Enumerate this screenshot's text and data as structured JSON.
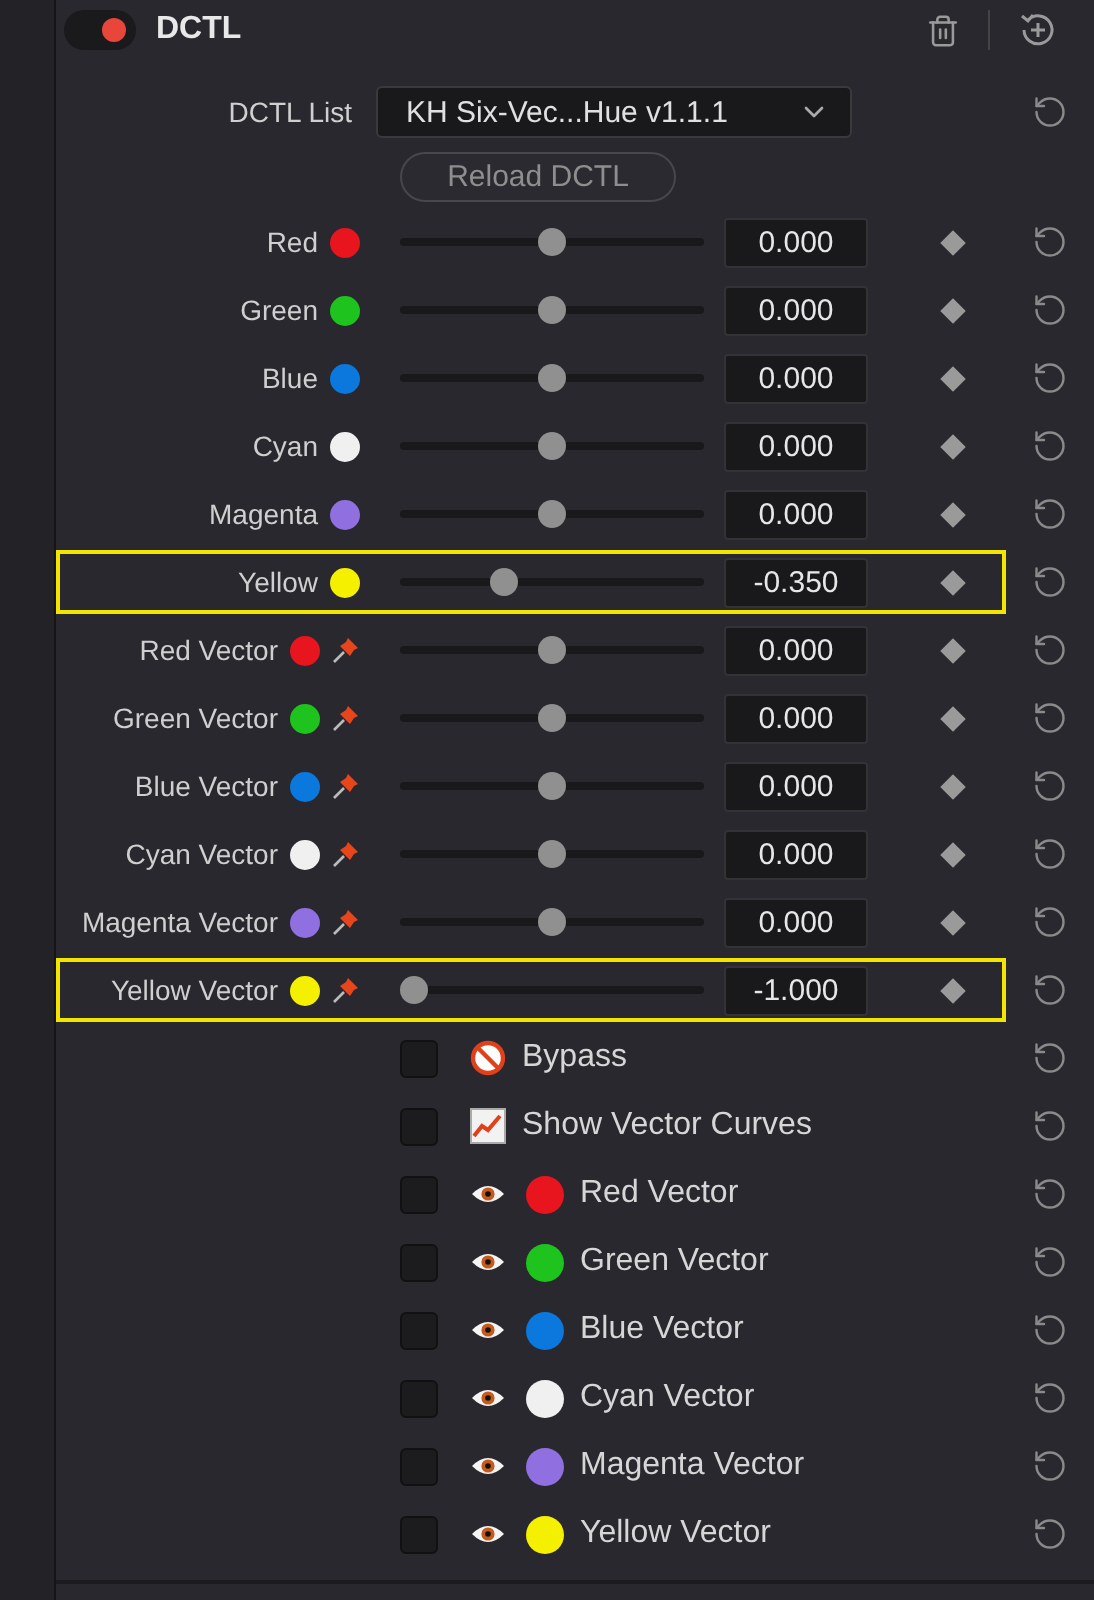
{
  "header": {
    "title": "DCTL",
    "enabled": true
  },
  "dctl_list": {
    "label": "DCTL List",
    "value": "KH Six-Vec...Hue v1.1.1"
  },
  "reload_button": "Reload DCTL",
  "sliders": [
    {
      "label": "Red",
      "color": "#e8141e",
      "pin": false,
      "level": 0.5,
      "value": "0.000",
      "highlighted": false
    },
    {
      "label": "Green",
      "color": "#1ec31e",
      "pin": false,
      "level": 0.5,
      "value": "0.000",
      "highlighted": false
    },
    {
      "label": "Blue",
      "color": "#0a78dc",
      "pin": false,
      "level": 0.5,
      "value": "0.000",
      "highlighted": false
    },
    {
      "label": "Cyan",
      "color": "#f0f0f0",
      "pin": false,
      "level": 0.5,
      "value": "0.000",
      "highlighted": false
    },
    {
      "label": "Magenta",
      "color": "#9070e0",
      "pin": false,
      "level": 0.5,
      "value": "0.000",
      "highlighted": false
    },
    {
      "label": "Yellow",
      "color": "#f5f000",
      "pin": false,
      "level": 0.325,
      "value": "-0.350",
      "highlighted": true
    },
    {
      "label": "Red Vector",
      "color": "#e8141e",
      "pin": true,
      "level": 0.5,
      "value": "0.000",
      "highlighted": false
    },
    {
      "label": "Green Vector",
      "color": "#1ec31e",
      "pin": true,
      "level": 0.5,
      "value": "0.000",
      "highlighted": false
    },
    {
      "label": "Blue Vector",
      "color": "#0a78dc",
      "pin": true,
      "level": 0.5,
      "value": "0.000",
      "highlighted": false
    },
    {
      "label": "Cyan Vector",
      "color": "#f0f0f0",
      "pin": true,
      "level": 0.5,
      "value": "0.000",
      "highlighted": false
    },
    {
      "label": "Magenta Vector",
      "color": "#9070e0",
      "pin": true,
      "level": 0.5,
      "value": "0.000",
      "highlighted": false
    },
    {
      "label": "Yellow Vector",
      "color": "#f5f000",
      "pin": true,
      "level": 0,
      "value": "-1.000",
      "highlighted": true
    }
  ],
  "checkboxes": [
    {
      "label": "Bypass",
      "kind": "bypass",
      "checked": false
    },
    {
      "label": "Show Vector Curves",
      "kind": "curves",
      "checked": false
    },
    {
      "label": "Red Vector",
      "kind": "vector",
      "color": "#e8141e",
      "checked": false
    },
    {
      "label": "Green Vector",
      "kind": "vector",
      "color": "#1ec31e",
      "checked": false
    },
    {
      "label": "Blue Vector",
      "kind": "vector",
      "color": "#0a78dc",
      "checked": false
    },
    {
      "label": "Cyan Vector",
      "kind": "vector",
      "color": "#f0f0f0",
      "checked": false
    },
    {
      "label": "Magenta Vector",
      "kind": "vector",
      "color": "#9070e0",
      "checked": false
    },
    {
      "label": "Yellow Vector",
      "kind": "vector",
      "color": "#f5f000",
      "checked": false
    }
  ]
}
